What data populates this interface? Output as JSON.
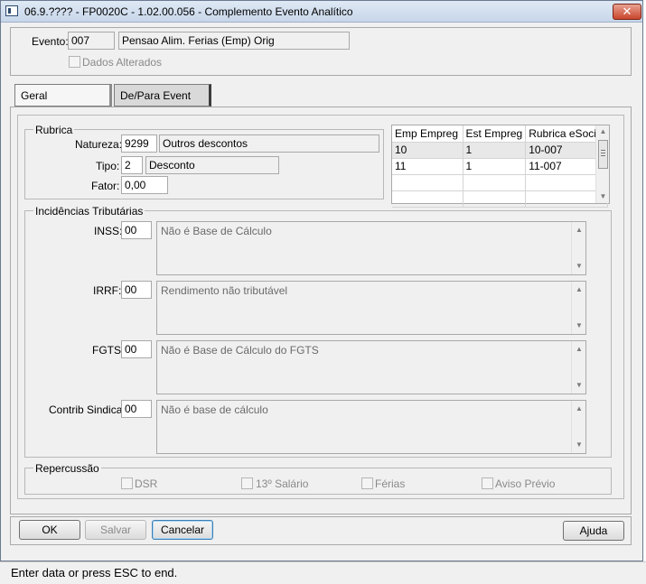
{
  "window": {
    "title": "06.9.???? - FP0020C - 1.02.00.056 - Complemento Evento Analítico",
    "close_label": "✕"
  },
  "header": {
    "evento_label": "Evento:",
    "evento_code": "007",
    "evento_desc": "Pensao Alim. Ferias (Emp) Orig",
    "dados_alterados_label": "Dados Alterados"
  },
  "tabs": [
    {
      "label": "Geral",
      "active": true
    },
    {
      "label": "De/Para Event",
      "active": false
    }
  ],
  "rubrica": {
    "title": "Rubrica",
    "natureza_label": "Natureza:",
    "natureza_code": "9299",
    "natureza_desc": "Outros descontos",
    "tipo_label": "Tipo:",
    "tipo_code": "2",
    "tipo_desc": "Desconto",
    "fator_label": "Fator:",
    "fator_value": "0,00"
  },
  "grid": {
    "columns": [
      "Emp Empreg",
      "Est Empreg",
      "Rubrica eSocial"
    ],
    "rows": [
      [
        "10",
        "1",
        "10-007"
      ],
      [
        "11",
        "1",
        "11-007"
      ]
    ]
  },
  "incidencias": {
    "title": "Incidências Tributárias",
    "inss_label": "INSS:",
    "inss_code": "00",
    "inss_desc": "Não é Base de Cálculo",
    "irrf_label": "IRRF:",
    "irrf_code": "00",
    "irrf_desc": "Rendimento não tributável",
    "fgts_label": "FGTS:",
    "fgts_code": "00",
    "fgts_desc": "Não é Base de Cálculo do FGTS",
    "sindical_label": "Contrib Sindical:",
    "sindical_code": "00",
    "sindical_desc": "Não é base de cálculo"
  },
  "repercussao": {
    "title": "Repercussão",
    "dsr": "DSR",
    "salario13": "13º Salário",
    "ferias": "Férias",
    "aviso": "Aviso Prévio"
  },
  "buttons": {
    "ok": "OK",
    "salvar": "Salvar",
    "cancelar": "Cancelar",
    "ajuda": "Ajuda"
  },
  "status": {
    "text": "Enter data or press ESC to end."
  }
}
